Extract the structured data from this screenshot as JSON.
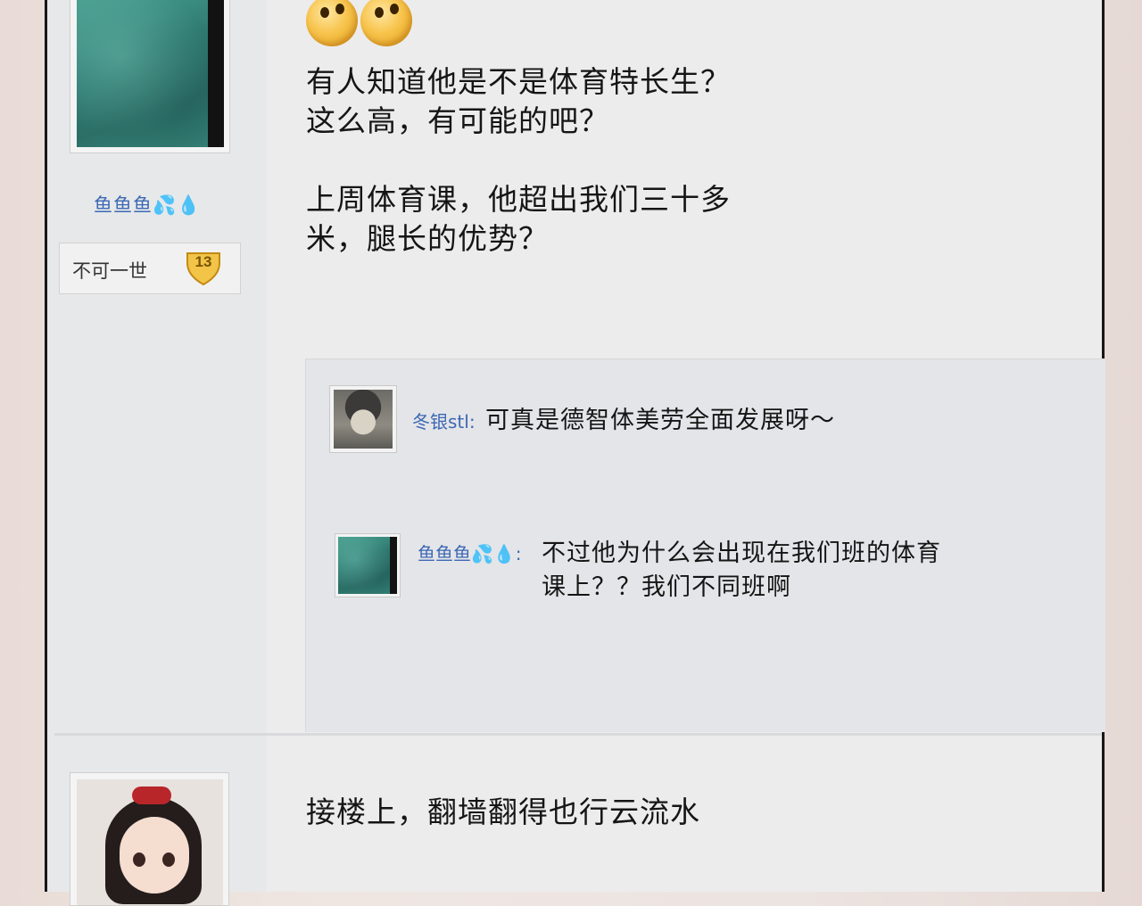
{
  "post1": {
    "author": "鱼鱼鱼💦💧",
    "badge_title": "不可一世",
    "level": "13",
    "emoji_icons": [
      "confused-face-icon",
      "confused-face-icon"
    ],
    "text": "有人知道他是不是体育特长生？\n这么高，有可能的吧？\n\n上周体育课，他超出我们三十多\n米，腿长的优势？"
  },
  "comments": [
    {
      "author": "冬银stl:",
      "text": "可真是德智体美劳全面发展呀～"
    },
    {
      "author": "鱼鱼鱼💦💧:",
      "text": "不过他为什么会出现在我们班的体育\n课上？？我们不同班啊"
    }
  ],
  "post2": {
    "text": "接楼上，翻墙翻得也行云流水"
  },
  "colors": {
    "username": "#3d68b5",
    "frame_border": "#161616",
    "background": "#ececed"
  }
}
